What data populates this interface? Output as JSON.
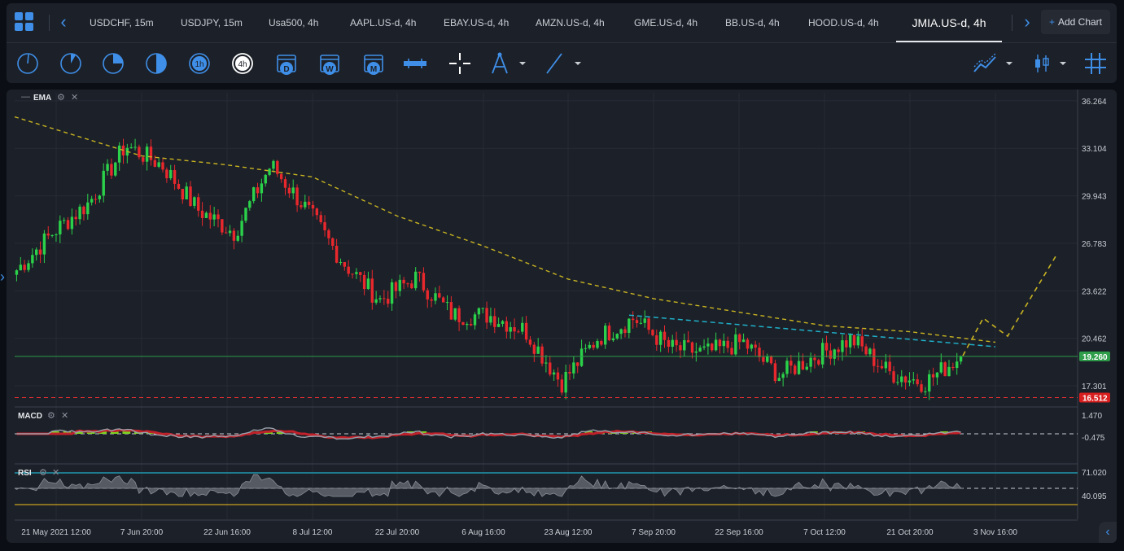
{
  "tabs": [
    {
      "label": "USDCHF, 15m"
    },
    {
      "label": "USDJPY, 15m"
    },
    {
      "label": "Usa500, 4h"
    },
    {
      "label": "AAPL.US-d, 4h"
    },
    {
      "label": "EBAY.US-d, 4h"
    },
    {
      "label": "AMZN.US-d, 4h"
    },
    {
      "label": "GME.US-d, 4h"
    },
    {
      "label": "BB.US-d, 4h"
    },
    {
      "label": "HOOD.US-d, 4h"
    },
    {
      "label": "JMIA.US-d, 4h"
    }
  ],
  "active_tab": "JMIA.US-d, 4h",
  "add_chart_label": "Add Chart",
  "toolbar": {
    "timeframe_4h": "4h",
    "timeframe_1h": "1h",
    "cal_d": "D",
    "cal_w": "W",
    "cal_m": "M"
  },
  "indicators": {
    "ema_label": "EMA",
    "macd_label": "MACD",
    "rsi_label": "RSI"
  },
  "price_axis": {
    "ticks": [
      "36.264",
      "33.104",
      "29.943",
      "26.783",
      "23.622",
      "20.462",
      "17.301"
    ],
    "current_price": "19.260",
    "alert_price": "16.512"
  },
  "macd_axis": {
    "ticks": [
      "1.470",
      "-0.475"
    ]
  },
  "rsi_axis": {
    "ticks": [
      "71.020",
      "40.095"
    ]
  },
  "time_axis": {
    "ticks": [
      "21 May 2021 12:00",
      "7 Jun 20:00",
      "22 Jun 16:00",
      "8 Jul 12:00",
      "22 Jul 20:00",
      "6 Aug 16:00",
      "23 Aug 12:00",
      "7 Sep 20:00",
      "22 Sep 16:00",
      "7 Oct 12:00",
      "21 Oct 20:00",
      "3 Nov 16:00"
    ]
  },
  "colors": {
    "accent": "#3f8fe8",
    "up_candle": "#2bd14a",
    "down_candle": "#e8282d",
    "ema_line": "#c8b422",
    "trendline": "#1fb0c8",
    "current_price_line": "#2e9e4a",
    "alert_line": "#e83030"
  },
  "chart_data": {
    "type": "candlestick",
    "symbol": "JMIA.US-d",
    "timeframe": "4h",
    "ylim": [
      16.0,
      36.8
    ],
    "close_series": [
      {
        "x": "21 May 2021 12:00",
        "y": 25.0
      },
      {
        "x": "28 May",
        "y": 27.5
      },
      {
        "x": "2 Jun",
        "y": 29.5
      },
      {
        "x": "7 Jun 20:00",
        "y": 33.3
      },
      {
        "x": "10 Jun",
        "y": 32.0
      },
      {
        "x": "15 Jun",
        "y": 29.0
      },
      {
        "x": "22 Jun 16:00",
        "y": 27.5
      },
      {
        "x": "29 Jun",
        "y": 32.0
      },
      {
        "x": "2 Jul",
        "y": 29.0
      },
      {
        "x": "8 Jul 12:00",
        "y": 25.5
      },
      {
        "x": "14 Jul",
        "y": 23.0
      },
      {
        "x": "22 Jul 20:00",
        "y": 24.5
      },
      {
        "x": "29 Jul",
        "y": 22.0
      },
      {
        "x": "6 Aug 16:00",
        "y": 22.0
      },
      {
        "x": "12 Aug",
        "y": 21.0
      },
      {
        "x": "23 Aug 12:00",
        "y": 17.5
      },
      {
        "x": "30 Aug",
        "y": 20.5
      },
      {
        "x": "7 Sep 20:00",
        "y": 21.8
      },
      {
        "x": "14 Sep",
        "y": 19.8
      },
      {
        "x": "22 Sep 16:00",
        "y": 19.5
      },
      {
        "x": "29 Sep",
        "y": 20.2
      },
      {
        "x": "7 Oct 12:00",
        "y": 18.0
      },
      {
        "x": "14 Oct",
        "y": 19.3
      },
      {
        "x": "21 Oct 20:00",
        "y": 20.4
      },
      {
        "x": "27 Oct",
        "y": 18.2
      },
      {
        "x": "1 Nov",
        "y": 17.5
      },
      {
        "x": "2 Nov",
        "y": 19.26
      }
    ],
    "ema_series": [
      {
        "x": "21 May 2021 12:00",
        "y": 35.2
      },
      {
        "x": "7 Jun 20:00",
        "y": 32.6
      },
      {
        "x": "22 Jun 16:00",
        "y": 32.0
      },
      {
        "x": "8 Jul 12:00",
        "y": 31.2
      },
      {
        "x": "22 Jul 20:00",
        "y": 28.6
      },
      {
        "x": "6 Aug 16:00",
        "y": 26.6
      },
      {
        "x": "23 Aug 12:00",
        "y": 24.4
      },
      {
        "x": "7 Sep 20:00",
        "y": 23.1
      },
      {
        "x": "22 Sep 16:00",
        "y": 22.2
      },
      {
        "x": "7 Oct 12:00",
        "y": 21.3
      },
      {
        "x": "21 Oct 20:00",
        "y": 20.9
      },
      {
        "x": "3 Nov 16:00",
        "y": 20.2
      }
    ],
    "current_price": 19.26,
    "alert_level": 16.512,
    "trendline": {
      "from": {
        "x": "7 Sep 20:00",
        "y": 22.0
      },
      "to": {
        "x": "3 Nov 16:00",
        "y": 19.9
      }
    },
    "projection": [
      {
        "x": "2 Nov",
        "y": 19.3
      },
      {
        "x": "3 Nov",
        "y": 21.8
      },
      {
        "x": "5 Nov",
        "y": 20.6
      },
      {
        "x": "10 Nov",
        "y": 26.0
      }
    ]
  }
}
